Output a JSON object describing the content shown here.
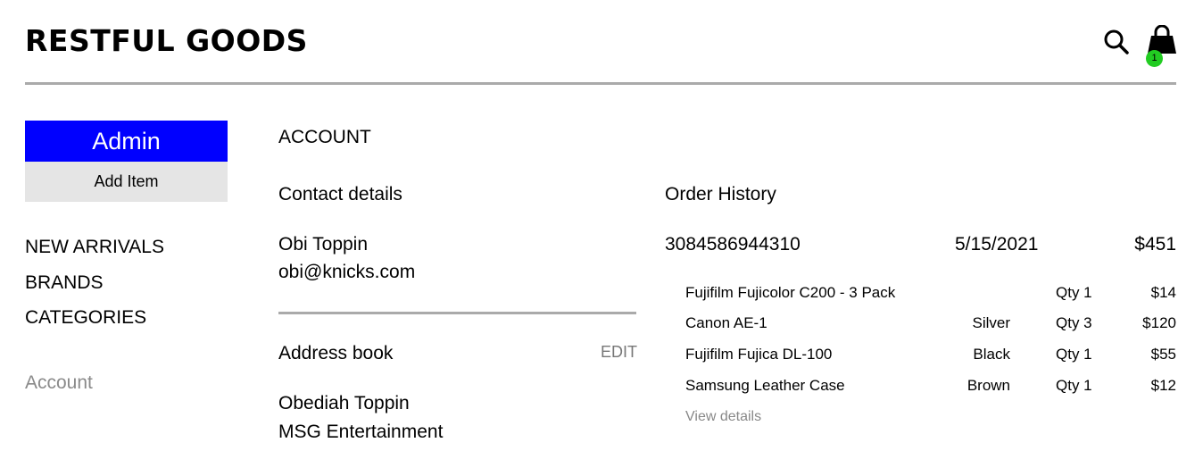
{
  "header": {
    "brand": "RESTFUL GOODS",
    "cart_count": "1"
  },
  "sidebar": {
    "admin_label": "Admin",
    "add_item_label": "Add Item",
    "nav": [
      "NEW ARRIVALS",
      "BRANDS",
      "CATEGORIES"
    ],
    "account_label": "Account"
  },
  "account": {
    "title": "ACCOUNT",
    "contact": {
      "heading": "Contact details",
      "name": "Obi Toppin",
      "email": "obi@knicks.com"
    },
    "address": {
      "heading": "Address book",
      "edit_label": "EDIT",
      "name": "Obediah Toppin",
      "company": "MSG Entertainment"
    },
    "orders": {
      "heading": "Order History",
      "order": {
        "number": "3084586944310",
        "date": "5/15/2021",
        "total": "$451",
        "items": [
          {
            "name": "Fujifilm Fujicolor C200 - 3 Pack",
            "variant": "",
            "qty": "Qty 1",
            "price": "$14"
          },
          {
            "name": "Canon AE-1",
            "variant": "Silver",
            "qty": "Qty 3",
            "price": "$120"
          },
          {
            "name": "Fujifilm Fujica DL-100",
            "variant": "Black",
            "qty": "Qty 1",
            "price": "$55"
          },
          {
            "name": "Samsung Leather Case",
            "variant": "Brown",
            "qty": "Qty 1",
            "price": "$12"
          }
        ],
        "view_details_label": "View details"
      }
    }
  },
  "colors": {
    "admin_bg": "#0000ff",
    "add_item_bg": "#e5e5e5",
    "badge": "#22cc22",
    "divider": "#aaaaaa"
  }
}
